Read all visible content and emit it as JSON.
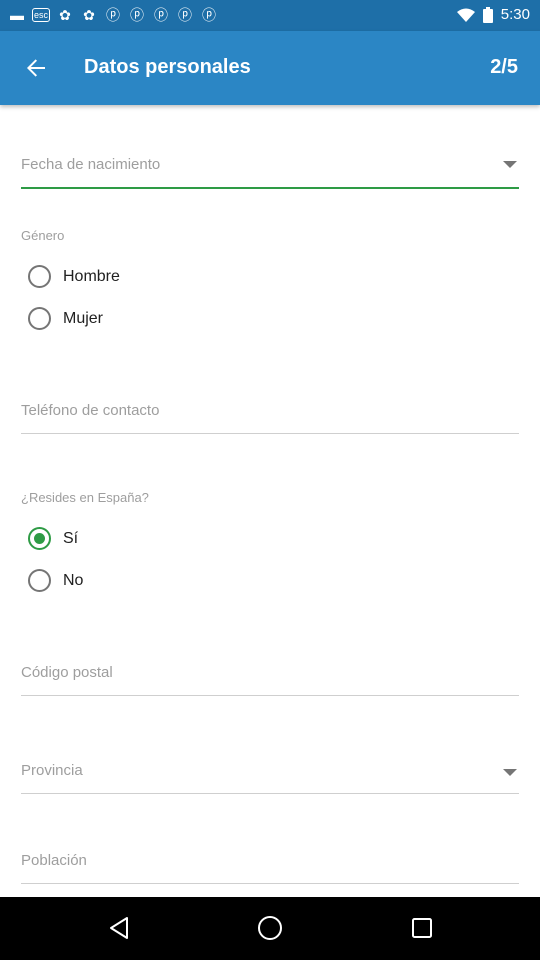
{
  "status_bar": {
    "time": "5:30",
    "icons": [
      "unknown-icon",
      "esc-icon",
      "flower-icon",
      "flower-icon",
      "pinterest-icon",
      "pinterest-icon",
      "pinterest-icon",
      "pinterest-icon",
      "pinterest-icon",
      "wifi-icon",
      "battery-icon"
    ],
    "esc_label": "esc"
  },
  "app_bar": {
    "title": "Datos personales",
    "step": "2/5"
  },
  "form": {
    "birth_date_placeholder": "Fecha de nacimiento",
    "gender_label": "Género",
    "gender_options": [
      {
        "label": "Hombre",
        "checked": false
      },
      {
        "label": "Mujer",
        "checked": false
      }
    ],
    "phone_placeholder": "Teléfono de contacto",
    "spain_label": "¿Resides en España?",
    "spain_options": [
      {
        "label": "Sí",
        "checked": true
      },
      {
        "label": "No",
        "checked": false
      }
    ],
    "postal_placeholder": "Código postal",
    "province_placeholder": "Provincia",
    "town_placeholder": "Población"
  },
  "colors": {
    "status_bar": "#1e6fa8",
    "app_bar": "#2b86c5",
    "accent": "#2e9b45"
  }
}
